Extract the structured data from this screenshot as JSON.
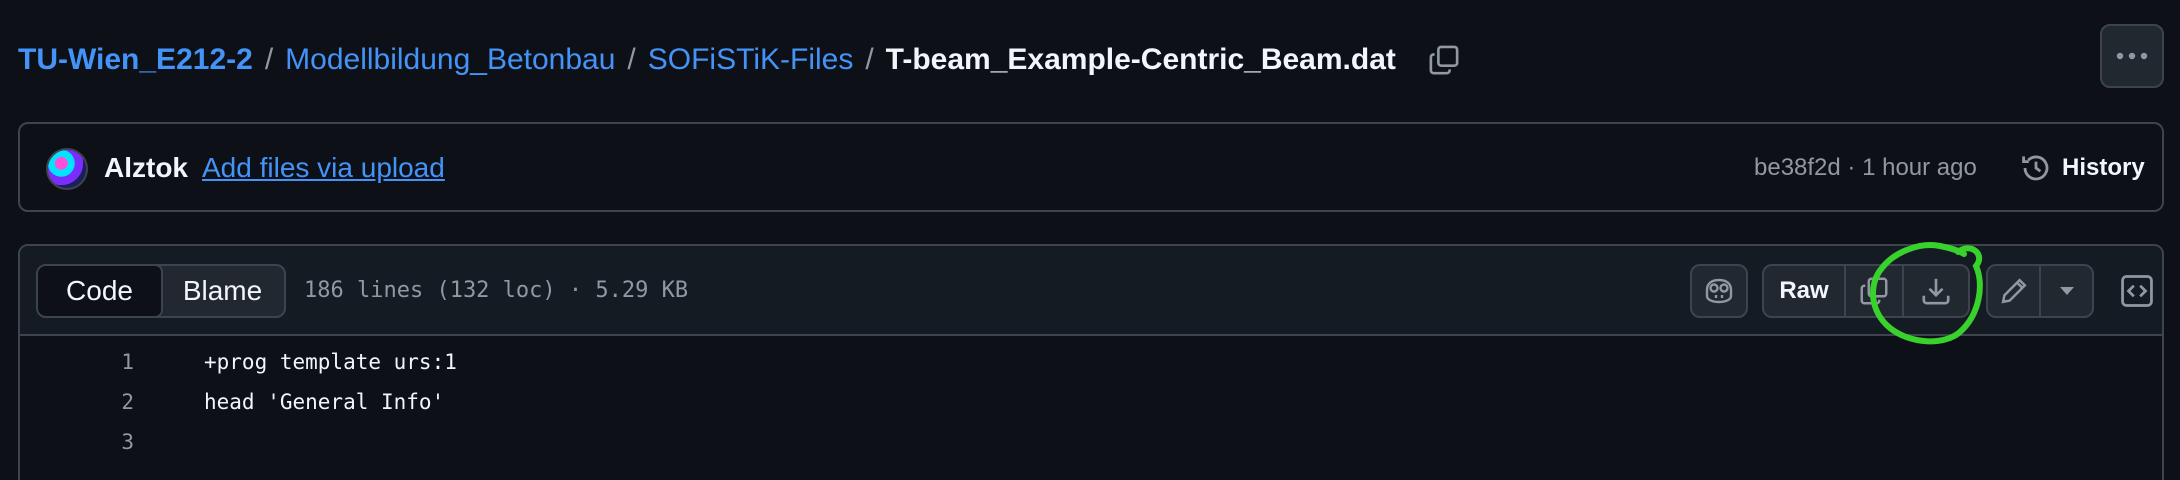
{
  "breadcrumb": {
    "owner": "TU-Wien_E212-2",
    "repo": "Modellbildung_Betonbau",
    "folder": "SOFiSTiK-Files",
    "file": "T-beam_Example-Centric_Beam.dat",
    "separator": "/"
  },
  "commit": {
    "author": "Alztok",
    "message": "Add files via upload",
    "meta": "be38f2d · 1 hour ago",
    "history_label": "History"
  },
  "file_header": {
    "tabs": [
      {
        "label": "Code",
        "active": true
      },
      {
        "label": "Blame",
        "active": false
      }
    ],
    "info": "186 lines (132 loc) · 5.29 KB",
    "raw_label": "Raw"
  },
  "code_lines": [
    {
      "number": "1",
      "text": "+prog template urs:1"
    },
    {
      "number": "2",
      "text": "head 'General Info'"
    },
    {
      "number": "3",
      "text": ""
    }
  ],
  "icons": {
    "copy_path": "copy-icon",
    "kebab": "kebab-horizontal-icon",
    "history": "history-icon",
    "copilot": "copilot-icon",
    "copy_raw": "copy-icon",
    "download": "download-icon",
    "edit": "pencil-icon",
    "more_edit": "triangle-down-icon",
    "symbols": "code-square-icon"
  },
  "colors": {
    "background": "#0d1117",
    "link": "#4493f8",
    "border": "#3d444d",
    "muted": "#9198a1",
    "annotation": "#39d12c"
  }
}
